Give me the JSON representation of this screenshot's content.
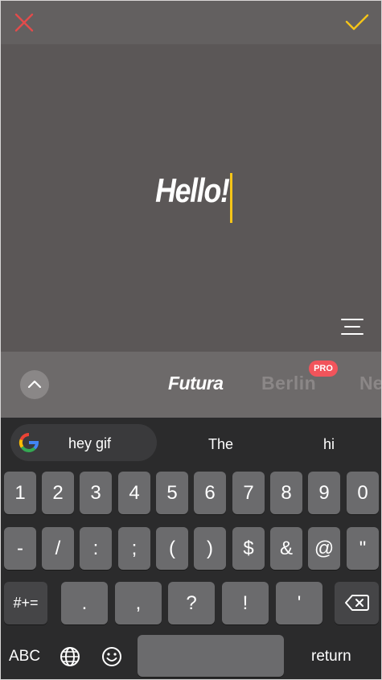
{
  "editor": {
    "text": "Hello!"
  },
  "fonts": [
    {
      "label": "Futura",
      "selected": true
    },
    {
      "label": "Berlin",
      "badge": "PRO"
    },
    {
      "label": "Ne"
    }
  ],
  "colors": {
    "close": "#e24b4b",
    "confirm": "#f5c518",
    "caret": "#f5c518",
    "pro_badge": "#f2545b"
  },
  "suggestions": {
    "google": "hey gif",
    "s1": "The",
    "s2": "hi"
  },
  "keyboard": {
    "row1": [
      "1",
      "2",
      "3",
      "4",
      "5",
      "6",
      "7",
      "8",
      "9",
      "0"
    ],
    "row2": [
      "-",
      "/",
      ":",
      ";",
      "(",
      ")",
      "$",
      "&",
      "@",
      "\""
    ],
    "row3_left": "#+=",
    "row3": [
      ".",
      ",",
      "?",
      "!",
      "'"
    ],
    "abc": "ABC",
    "return": "return",
    "icons": [
      "globe-icon",
      "emoji-icon",
      "backspace-icon"
    ]
  }
}
